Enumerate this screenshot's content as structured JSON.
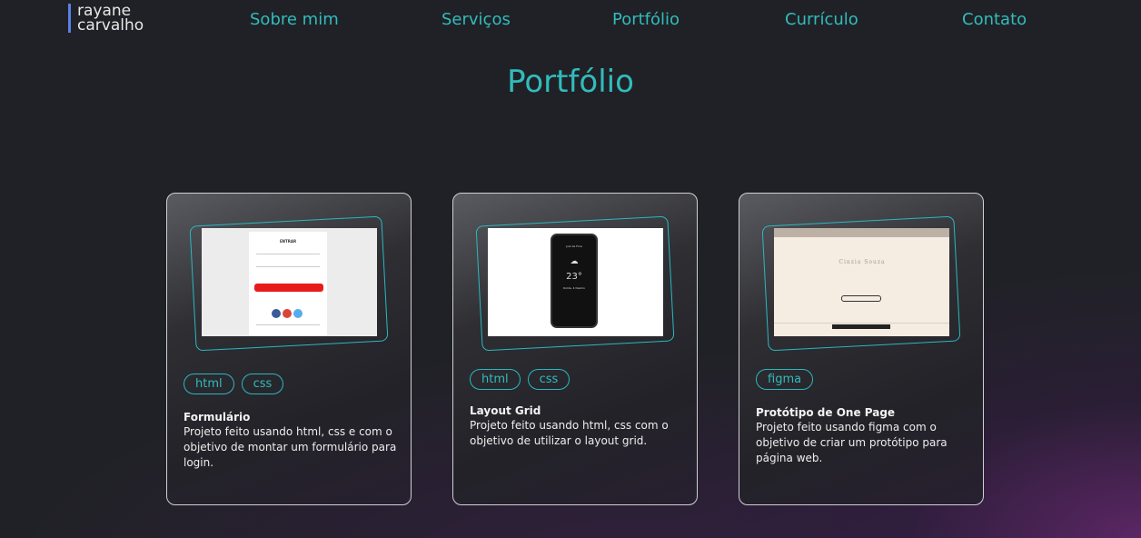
{
  "header": {
    "logo_line1": "rayane",
    "logo_line2": "carvalho",
    "nav": [
      "Sobre mim",
      "Serviços",
      "Portfólio",
      "Currículo",
      "Contato"
    ]
  },
  "section": {
    "title": "Portfólio"
  },
  "projects": [
    {
      "tags": [
        "html",
        "css"
      ],
      "title": "Formulário",
      "description": "Projeto feito usando html, css e com o objetivo de montar um formulário para login."
    },
    {
      "tags": [
        "html",
        "css"
      ],
      "title": "Layout Grid",
      "description": "Projeto feito usando html, css com o objetivo de utilizar o layout grid."
    },
    {
      "tags": [
        "figma"
      ],
      "title": "Protótipo de One Page",
      "description": "Projeto feito usando figma com o objetivo de criar um protótipo para página web."
    }
  ],
  "colors": {
    "accent": "#31bcbc",
    "background": "#202126",
    "logo_bar": "#5a7fe6"
  }
}
